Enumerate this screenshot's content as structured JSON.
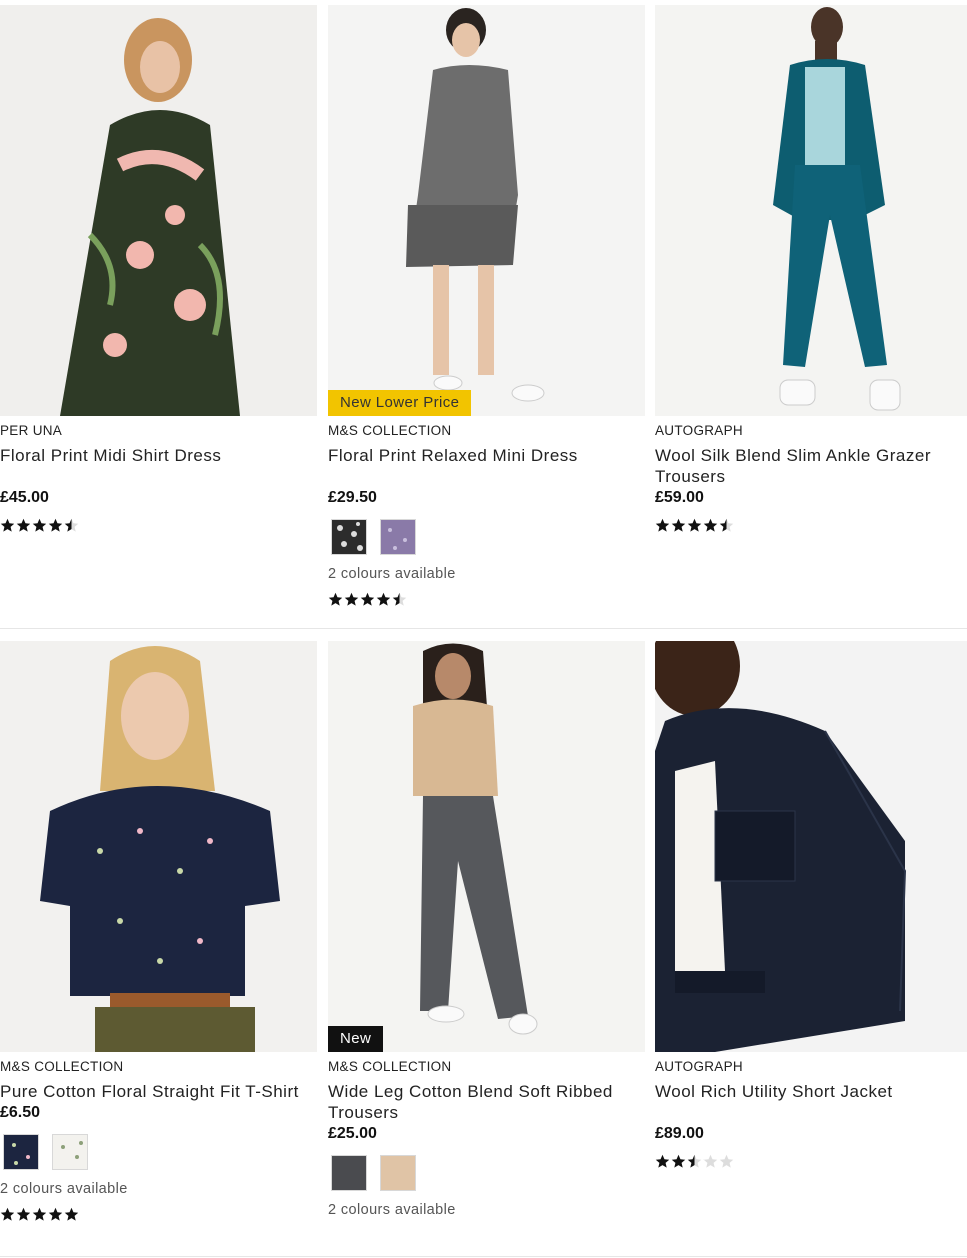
{
  "products": [
    {
      "brand": "PER UNA",
      "title": "Floral Print Midi Shirt Dress",
      "price": "£45.00",
      "badge": "",
      "rating": 4.5,
      "swatches": [],
      "colours_text": ""
    },
    {
      "brand": "M&S COLLECTION",
      "title": "Floral Print Relaxed Mini Dress",
      "price": "£29.50",
      "badge": "New Lower Price",
      "rating": 4.5,
      "swatches": [
        "#2c2c2c",
        "#8a7aa8"
      ],
      "colours_text": "2 colours available"
    },
    {
      "brand": "AUTOGRAPH",
      "title": "Wool Silk Blend Slim Ankle Grazer Trousers",
      "price": "£59.00",
      "badge": "",
      "rating": 4.5,
      "swatches": [],
      "colours_text": ""
    },
    {
      "brand": "M&S COLLECTION",
      "title": "Pure Cotton Floral Straight Fit T-Shirt",
      "price": "£6.50",
      "badge": "",
      "rating": 5,
      "swatches": [
        "#1c2540",
        "#f3f2ee"
      ],
      "colours_text": "2 colours available"
    },
    {
      "brand": "M&S COLLECTION",
      "title": "Wide Leg Cotton Blend Soft Ribbed Trousers",
      "price": "£25.00",
      "badge": "New",
      "rating": null,
      "swatches": [
        "#4a4b4f",
        "#e0c4a6"
      ],
      "colours_text": "2 colours available"
    },
    {
      "brand": "AUTOGRAPH",
      "title": "Wool Rich Utility Short Jacket",
      "price": "£89.00",
      "badge": "",
      "rating": 2.5,
      "swatches": [],
      "colours_text": ""
    }
  ],
  "colors": {
    "badge_yellow": "#f2c400",
    "badge_black": "#111111",
    "star_filled": "#111111",
    "star_empty": "#dddddd"
  }
}
